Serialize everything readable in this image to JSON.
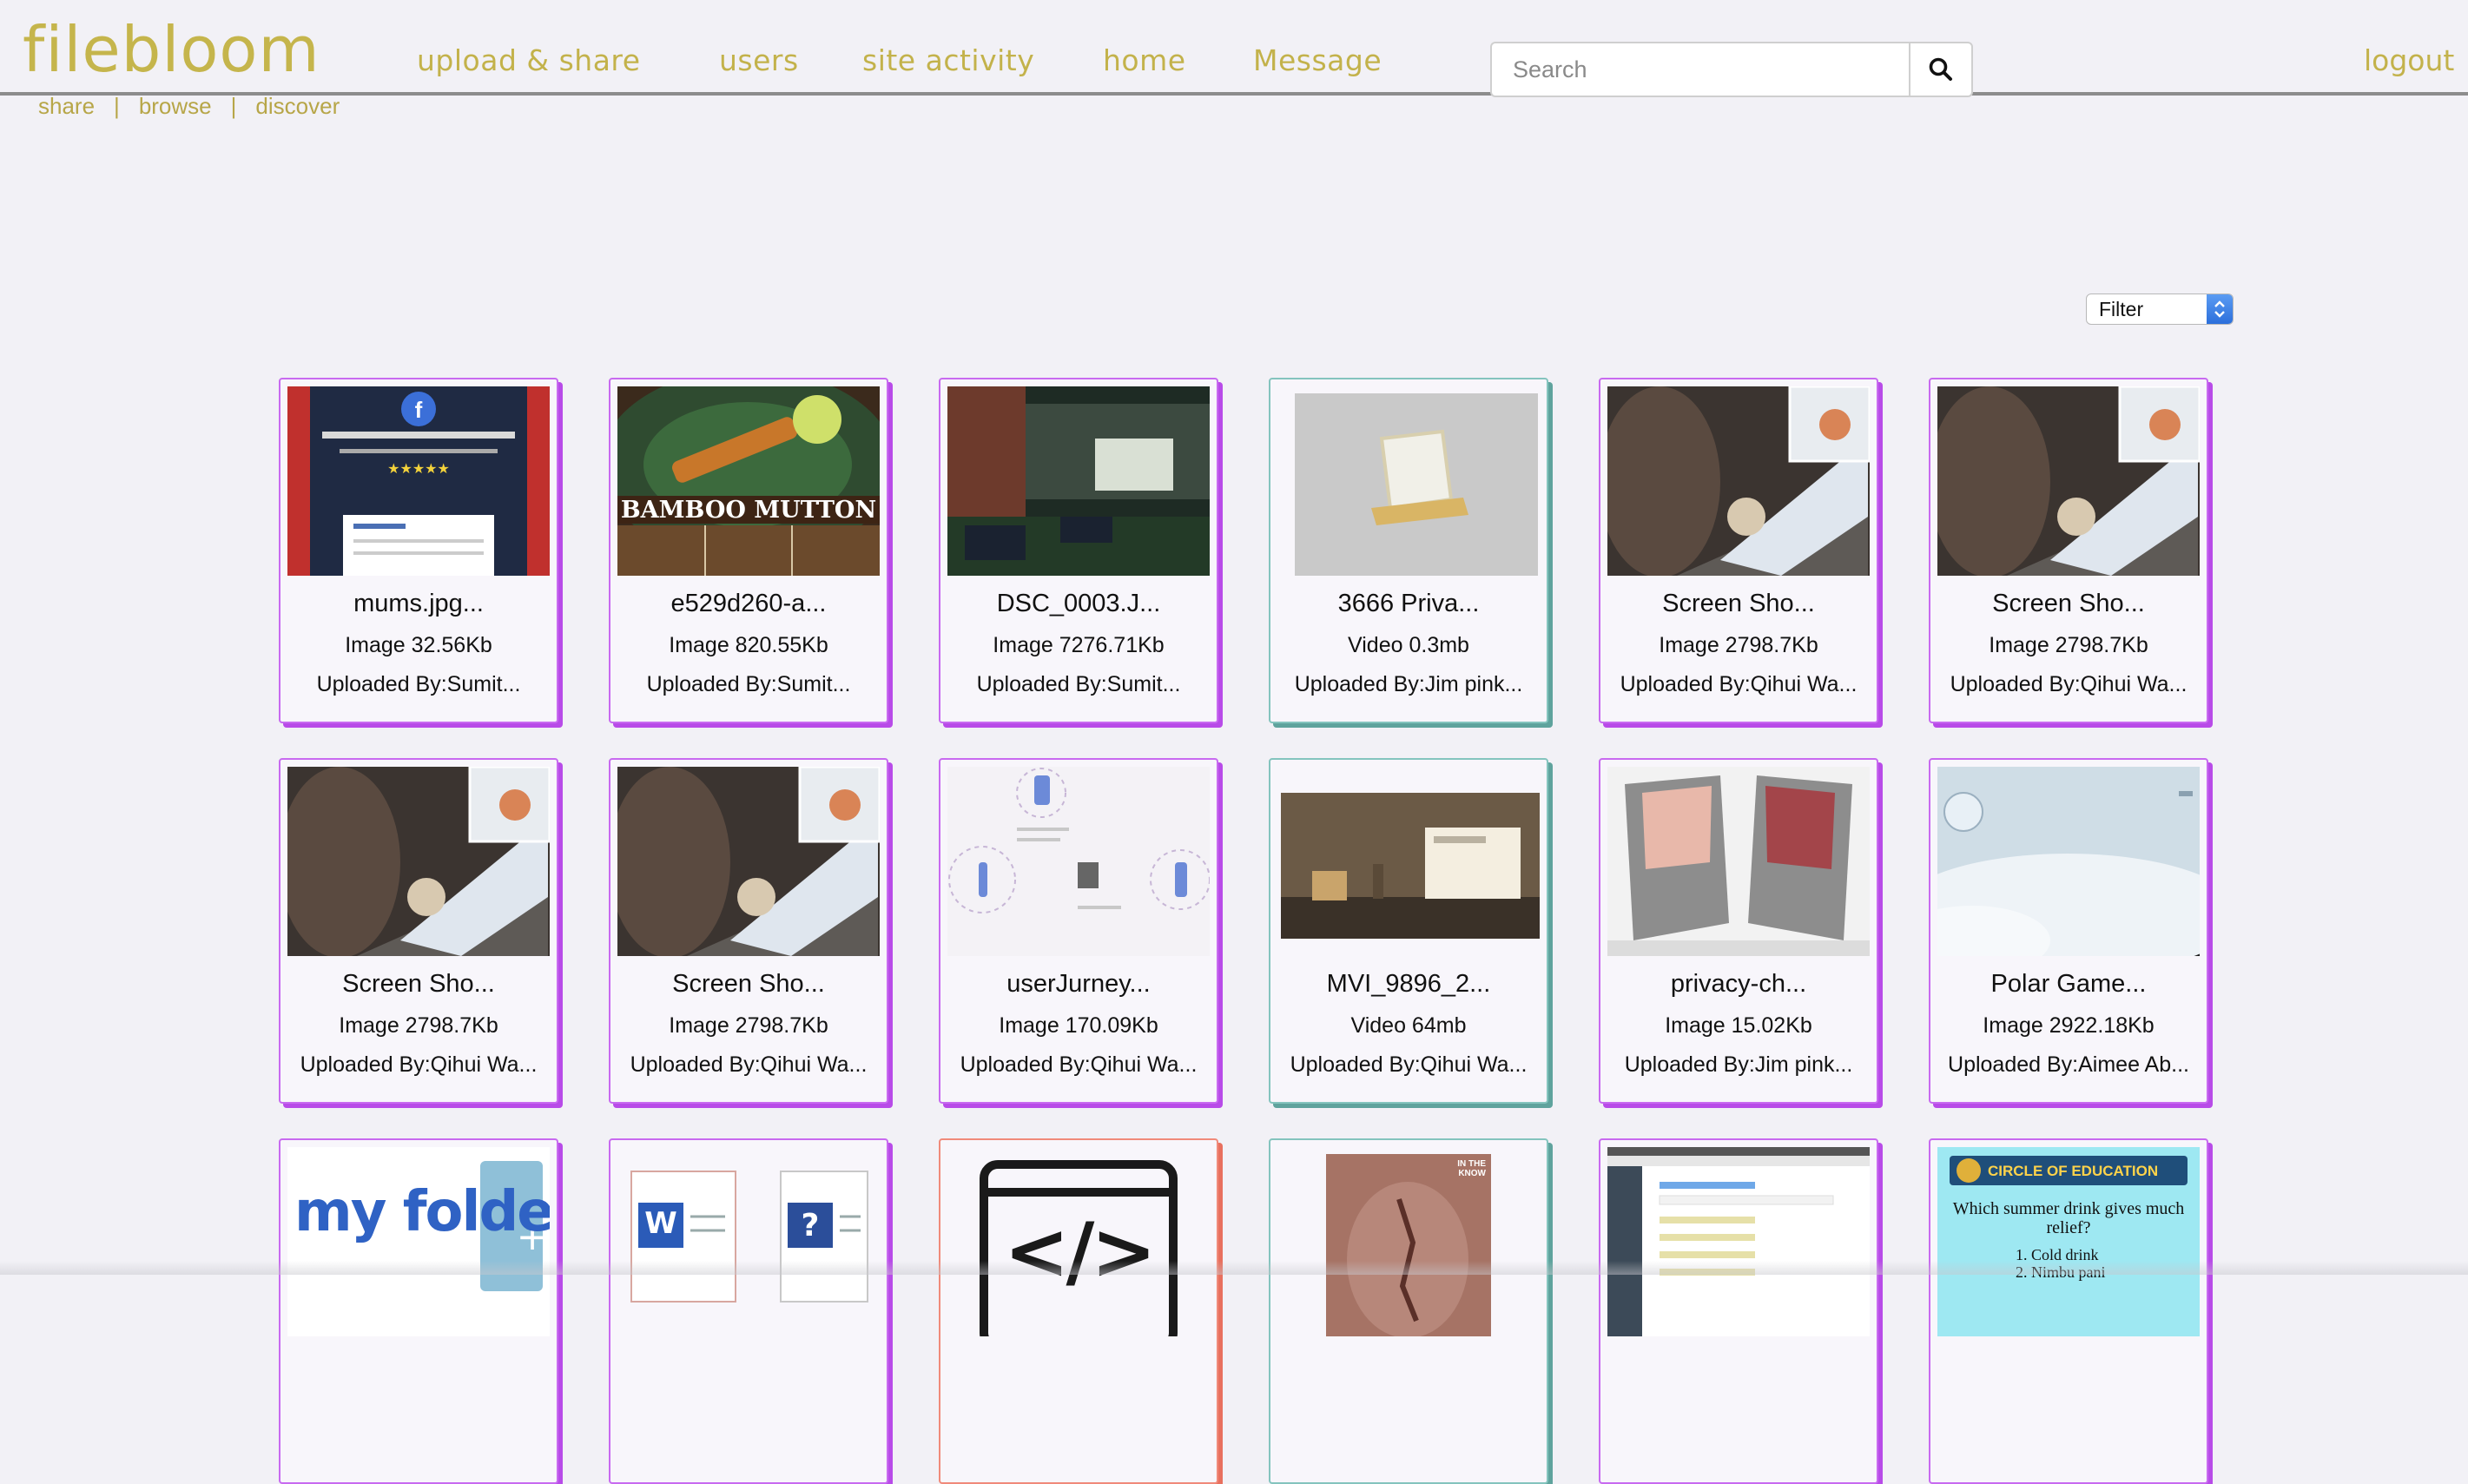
{
  "brand": {
    "logo": "filebloom",
    "tagline": [
      "share",
      "browse",
      "discover"
    ],
    "color": "#c5b54c"
  },
  "nav": {
    "items": [
      "upload & share",
      "users",
      "site activity",
      "home",
      "Message"
    ],
    "logout": "logout"
  },
  "search": {
    "placeholder": "Search",
    "icon": "search-icon"
  },
  "filter": {
    "label": "Filter",
    "icon": "select-arrows-icon"
  },
  "files": [
    {
      "name": "mums.jpg...",
      "meta": "Image 32.56Kb",
      "uploader": "Uploaded By:Sumit...",
      "kind": "image",
      "thumb": "feedback-poster"
    },
    {
      "name": "e529d260-a...",
      "meta": "Image 820.55Kb",
      "uploader": "Uploaded By:Sumit...",
      "kind": "image",
      "thumb": "food-poster"
    },
    {
      "name": "DSC_0003.J...",
      "meta": "Image 7276.71Kb",
      "uploader": "Uploaded By:Sumit...",
      "kind": "image",
      "thumb": "restaurant-photo"
    },
    {
      "name": "3666 Priva...",
      "meta": "Video 0.3mb",
      "uploader": "Uploaded By:Jim pink...",
      "kind": "video",
      "thumb": "3d-model"
    },
    {
      "name": "Screen Sho...",
      "meta": "Image 2798.7Kb",
      "uploader": "Uploaded By:Qihui Wa...",
      "kind": "image",
      "thumb": "table-photo"
    },
    {
      "name": "Screen Sho...",
      "meta": "Image 2798.7Kb",
      "uploader": "Uploaded By:Qihui Wa...",
      "kind": "image",
      "thumb": "table-photo"
    },
    {
      "name": "Screen Sho...",
      "meta": "Image 2798.7Kb",
      "uploader": "Uploaded By:Qihui Wa...",
      "kind": "image",
      "thumb": "table-photo"
    },
    {
      "name": "Screen Sho...",
      "meta": "Image 2798.7Kb",
      "uploader": "Uploaded By:Qihui Wa...",
      "kind": "image",
      "thumb": "table-photo"
    },
    {
      "name": "userJurney...",
      "meta": "Image 170.09Kb",
      "uploader": "Uploaded By:Qihui Wa...",
      "kind": "image",
      "thumb": "journey-diagram"
    },
    {
      "name": "MVI_9896_2...",
      "meta": "Video 64mb",
      "uploader": "Uploaded By:Qihui Wa...",
      "kind": "video",
      "thumb": "video-still"
    },
    {
      "name": "privacy-ch...",
      "meta": "Image 15.02Kb",
      "uploader": "Uploaded By:Jim pink...",
      "kind": "image",
      "thumb": "privacy-chairs"
    },
    {
      "name": "Polar Game...",
      "meta": "Image 2922.18Kb",
      "uploader": "Uploaded By:Aimee Ab...",
      "kind": "image",
      "thumb": "polar-game"
    },
    {
      "name": "",
      "meta": "",
      "uploader": "",
      "kind": "image",
      "thumb": "my-folder",
      "thumb_text": "my folder"
    },
    {
      "name": "",
      "meta": "",
      "uploader": "",
      "kind": "image",
      "thumb": "word-docs",
      "thumb_text": "W"
    },
    {
      "name": "",
      "meta": "",
      "uploader": "",
      "kind": "code",
      "thumb": "code-icon",
      "thumb_text": "</>"
    },
    {
      "name": "",
      "meta": "",
      "uploader": "",
      "kind": "video",
      "thumb": "sydney-poster",
      "thumb_text": "IN THE KNOW"
    },
    {
      "name": "",
      "meta": "",
      "uploader": "",
      "kind": "image",
      "thumb": "app-screenshot"
    },
    {
      "name": "",
      "meta": "",
      "uploader": "",
      "kind": "image",
      "thumb": "education-poster",
      "thumb_text": "CIRCLE OF EDUCATION",
      "thumb_question": "Which summer drink gives much relief?",
      "thumb_options": [
        "1. Cold drink",
        "2. Nimbu pani"
      ]
    }
  ]
}
